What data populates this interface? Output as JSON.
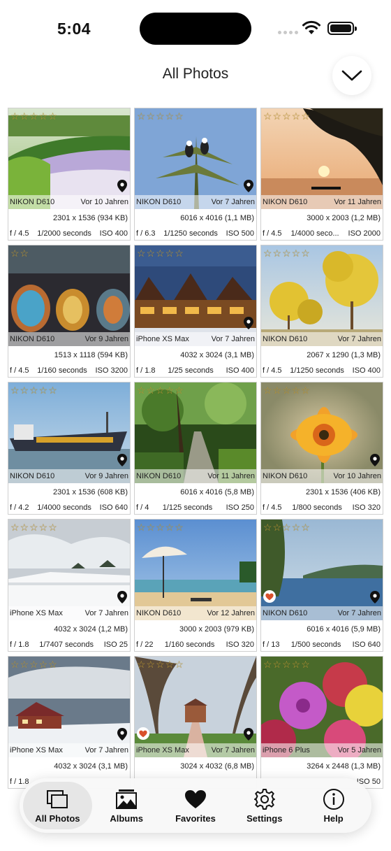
{
  "status_bar": {
    "time": "5:04"
  },
  "header": {
    "title": "All Photos"
  },
  "photos": [
    {
      "camera": "NIKON D610",
      "age": "Vor 10 Jahren",
      "dims": "2301 x 1536 (934 KB)",
      "aperture": "f / 4.5",
      "shutter": "1/2000 seconds",
      "iso": "ISO 400",
      "stars": "☆☆☆☆☆",
      "favorite": false,
      "location": true,
      "scene": "flowers"
    },
    {
      "camera": "NIKON D610",
      "age": "Vor 7 Jahren",
      "dims": "6016 x 4016 (1,1 MB)",
      "aperture": "f / 6.3",
      "shutter": "1/1250 seconds",
      "iso": "ISO 500",
      "stars": "☆☆☆☆☆",
      "favorite": false,
      "location": true,
      "scene": "birds"
    },
    {
      "camera": "NIKON D610",
      "age": "Vor 11 Jahren",
      "dims": "3000 x 2003 (1,2 MB)",
      "aperture": "f / 4.5",
      "shutter": "1/4000 seco...",
      "iso": "ISO 2000",
      "stars": "☆☆☆☆☆",
      "favorite": false,
      "location": false,
      "scene": "sunset"
    },
    {
      "camera": "NIKON D610",
      "age": "Vor 9 Jahren",
      "dims": "1513 x 1118 (594 KB)",
      "aperture": "f / 4.5",
      "shutter": "1/160 seconds",
      "iso": "ISO 3200",
      "stars": "☆☆",
      "favorite": false,
      "location": false,
      "scene": "lamps"
    },
    {
      "camera": "iPhone XS Max",
      "age": "Vor 7 Jahren",
      "dims": "4032 x 3024 (3,1 MB)",
      "aperture": "f / 1.8",
      "shutter": "1/25 seconds",
      "iso": "ISO 400",
      "stars": "☆☆☆☆☆",
      "favorite": false,
      "location": true,
      "scene": "building"
    },
    {
      "camera": "NIKON D610",
      "age": "Vor 7 Jahren",
      "dims": "2067 x 1290 (1,3 MB)",
      "aperture": "f / 4.5",
      "shutter": "1/1250 seconds",
      "iso": "ISO 400",
      "stars": "☆☆☆☆☆",
      "favorite": false,
      "location": false,
      "scene": "yellowtrees"
    },
    {
      "camera": "NIKON D610",
      "age": "Vor 9 Jahren",
      "dims": "2301 x 1536 (608 KB)",
      "aperture": "f / 4.2",
      "shutter": "1/4000 seconds",
      "iso": "ISO 640",
      "stars": "☆☆☆☆☆",
      "favorite": false,
      "location": true,
      "scene": "ship"
    },
    {
      "camera": "NIKON D610",
      "age": "Vor 11 Jahren",
      "dims": "6016 x 4016 (5,8 MB)",
      "aperture": "f / 4",
      "shutter": "1/125 seconds",
      "iso": "ISO 250",
      "stars": "☆☆☆☆☆",
      "favorite": false,
      "location": false,
      "scene": "forest"
    },
    {
      "camera": "NIKON D610",
      "age": "Vor 10 Jahren",
      "dims": "2301 x 1536 (406 KB)",
      "aperture": "f / 4.5",
      "shutter": "1/800 seconds",
      "iso": "ISO 320",
      "stars": "☆☆☆☆☆",
      "favorite": false,
      "location": true,
      "scene": "gazania"
    },
    {
      "camera": "iPhone XS Max",
      "age": "Vor 7 Jahren",
      "dims": "4032 x 3024 (1,2 MB)",
      "aperture": "f / 1.8",
      "shutter": "1/7407 seconds",
      "iso": "ISO 25",
      "stars": "☆☆☆☆☆",
      "favorite": false,
      "location": true,
      "scene": "snow"
    },
    {
      "camera": "NIKON D610",
      "age": "Vor 12 Jahren",
      "dims": "3000 x 2003 (979 KB)",
      "aperture": "f / 22",
      "shutter": "1/160 seconds",
      "iso": "ISO 320",
      "stars": "☆☆☆☆☆",
      "favorite": false,
      "location": false,
      "scene": "beach"
    },
    {
      "camera": "NIKON D610",
      "age": "Vor 7 Jahren",
      "dims": "6016 x 4016 (5,9 MB)",
      "aperture": "f / 13",
      "shutter": "1/500 seconds",
      "iso": "ISO 640",
      "stars": "☆☆☆☆☆",
      "favorite": true,
      "location": true,
      "scene": "lake"
    },
    {
      "camera": "iPhone XS Max",
      "age": "Vor 7 Jahren",
      "dims": "4032 x 3024 (3,1 MB)",
      "aperture": "f / 1.8",
      "shutter": "",
      "iso": "",
      "stars": "☆☆☆☆☆",
      "favorite": false,
      "location": true,
      "scene": "snowhouse"
    },
    {
      "camera": "iPhone XS Max",
      "age": "Vor 7 Jahren",
      "dims": "3024 x 4032 (6,8 MB)",
      "aperture": "",
      "shutter": "",
      "iso": "",
      "stars": "☆☆☆☆☆",
      "favorite": true,
      "location": true,
      "scene": "park"
    },
    {
      "camera": "iPhone 6 Plus",
      "age": "Vor 5 Jahren",
      "dims": "3264 x 2448 (1,3 MB)",
      "aperture": "",
      "shutter": "",
      "iso": "ISO 50",
      "stars": "☆☆☆☆☆",
      "favorite": false,
      "location": false,
      "scene": "dahlias"
    }
  ],
  "tabbar": {
    "tabs": [
      {
        "label": "All Photos",
        "icon": "photos-stack-icon",
        "active": true
      },
      {
        "label": "Albums",
        "icon": "album-icon",
        "active": false
      },
      {
        "label": "Favorites",
        "icon": "heart-icon",
        "active": false
      },
      {
        "label": "Settings",
        "icon": "gear-icon",
        "active": false
      },
      {
        "label": "Help",
        "icon": "info-icon",
        "active": false
      }
    ]
  },
  "colors": {
    "star": "#c9a23a",
    "favorite": "#d9502b",
    "active_tab_bg": "#e6e6e6"
  }
}
